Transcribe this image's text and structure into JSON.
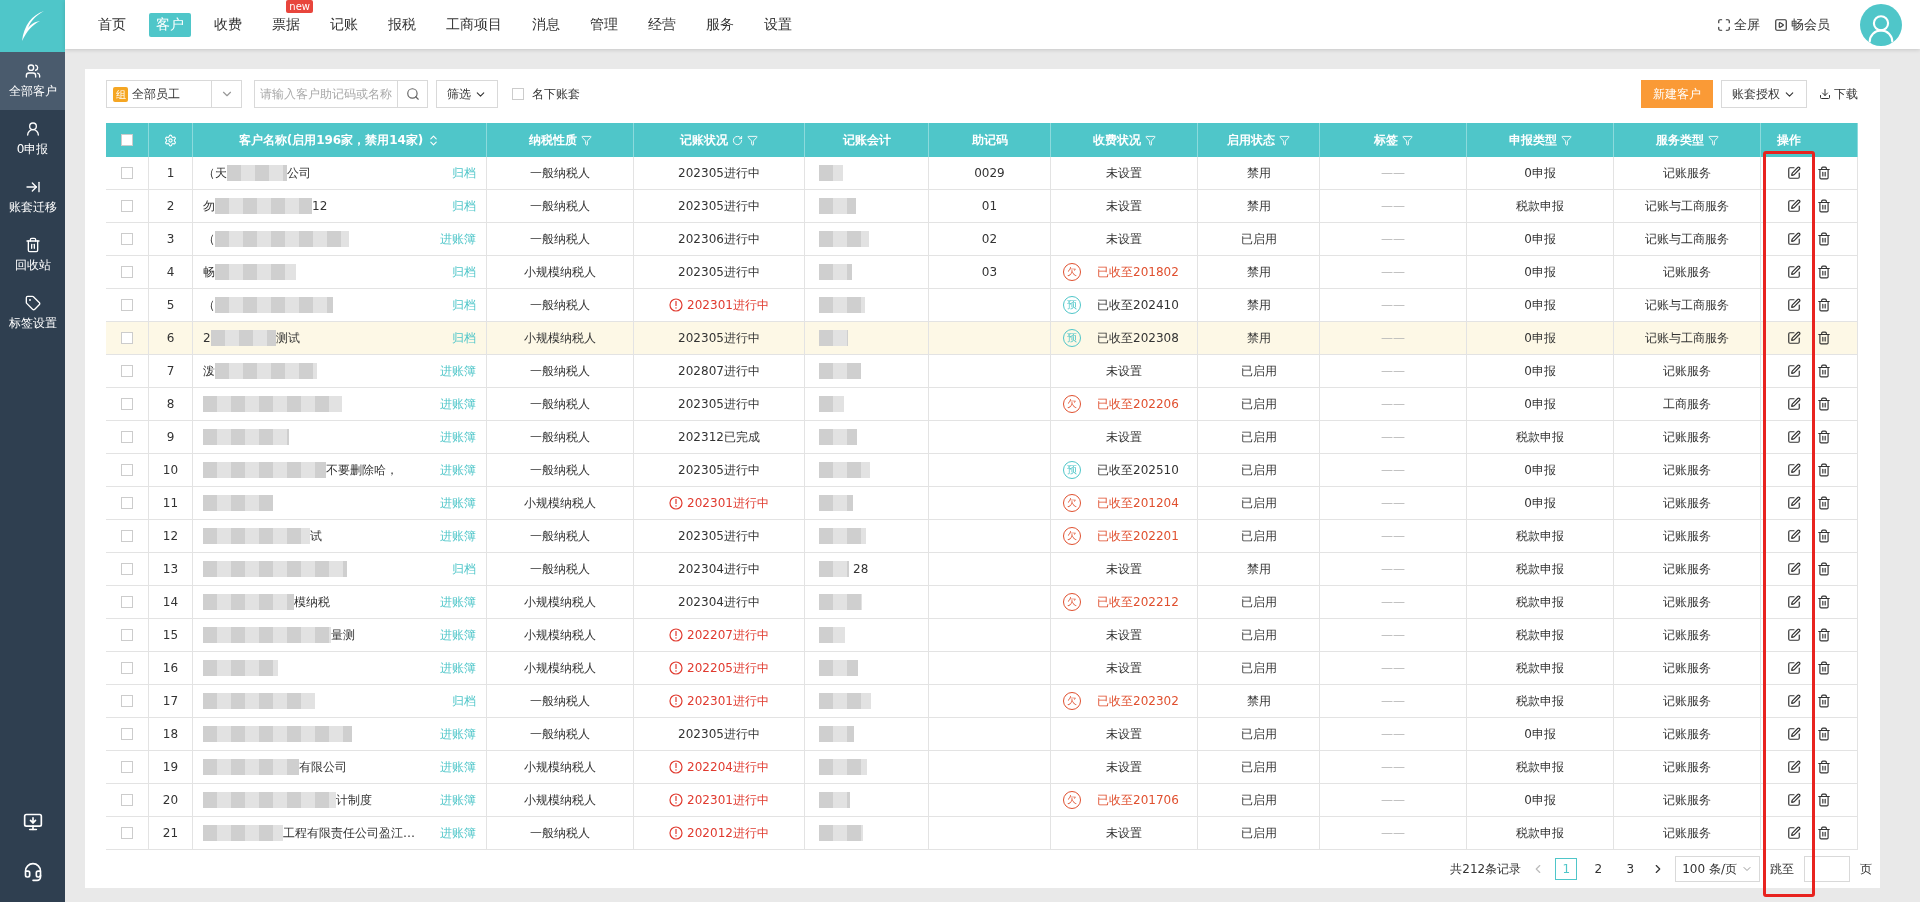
{
  "nav": {
    "items": [
      {
        "label": "首页",
        "selected": false
      },
      {
        "label": "客户",
        "selected": true
      },
      {
        "label": "收费",
        "selected": false
      },
      {
        "label": "票据",
        "selected": false,
        "badge": "new"
      },
      {
        "label": "记账",
        "selected": false
      },
      {
        "label": "报税",
        "selected": false
      },
      {
        "label": "工商项目",
        "selected": false
      },
      {
        "label": "消息",
        "selected": false
      },
      {
        "label": "管理",
        "selected": false
      },
      {
        "label": "经营",
        "selected": false
      },
      {
        "label": "服务",
        "selected": false
      },
      {
        "label": "设置",
        "selected": false
      }
    ],
    "fullscreen": "全屏",
    "member": "畅会员"
  },
  "sidebar": {
    "items": [
      {
        "label": "全部客户",
        "selected": true
      },
      {
        "label": "0申报",
        "selected": false
      },
      {
        "label": "账套迁移",
        "selected": false
      },
      {
        "label": "回收站",
        "selected": false
      },
      {
        "label": "标签设置",
        "selected": false
      }
    ]
  },
  "toolbar": {
    "staff_icon": "组",
    "staff": "全部员工",
    "search_placeholder": "请输入客户助记码或名称",
    "filter": "筛选",
    "mine": {
      "label": "名下账套",
      "checked": false
    },
    "new_customer": "新建客户",
    "authorize": "账套授权",
    "download": "下载"
  },
  "table": {
    "columns": [
      {
        "kind": "check",
        "checked": false
      },
      {
        "kind": "gear"
      },
      {
        "label": "客户名称(启用196家，禁用14家)",
        "kind": "sort"
      },
      {
        "label": "纳税性质",
        "kind": "filter"
      },
      {
        "label": "记账状况",
        "kind": "refresh"
      },
      {
        "label": "记账会计",
        "kind": "plain"
      },
      {
        "label": "助记码",
        "kind": "plain"
      },
      {
        "label": "收费状况",
        "kind": "filter"
      },
      {
        "label": "启用状态",
        "kind": "filter"
      },
      {
        "label": "标签",
        "kind": "filter"
      },
      {
        "label": "申报类型",
        "kind": "filter"
      },
      {
        "label": "服务类型",
        "kind": "filter"
      },
      {
        "label": "操作",
        "kind": "plain"
      }
    ],
    "rows": [
      {
        "no": "1",
        "name_start": "（天",
        "name_end": "公司",
        "link": "归档",
        "tax": "一般纳税人",
        "status": "202305进行中",
        "warn": false,
        "code": "0029",
        "overdue": false,
        "fee": "未设置",
        "enabled": "禁用",
        "tag": "——",
        "declare": "0申报",
        "service": "记账服务",
        "selected": false
      },
      {
        "no": "2",
        "name_start": "勿",
        "name_end": "12",
        "link": "归档",
        "tax": "一般纳税人",
        "status": "202305进行中",
        "warn": false,
        "code": "01",
        "overdue": false,
        "fee": "未设置",
        "enabled": "禁用",
        "tag": "——",
        "declare": "税款申报",
        "service": "记账与工商服务",
        "selected": false
      },
      {
        "no": "3",
        "name_start": "（",
        "link": "进账簿",
        "tax": "一般纳税人",
        "status": "202306进行中",
        "warn": false,
        "code": "02",
        "overdue": false,
        "fee": "未设置",
        "enabled": "已启用",
        "tag": "——",
        "declare": "0申报",
        "service": "记账与工商服务",
        "selected": false
      },
      {
        "no": "4",
        "name_start": "畅",
        "link": "归档",
        "tax": "小规模纳税人",
        "status": "202305进行中",
        "warn": false,
        "code": "03",
        "overdue": true,
        "fee_badge": "欠",
        "fee": "已收至201802",
        "enabled": "禁用",
        "tag": "——",
        "declare": "0申报",
        "service": "记账服务",
        "selected": false
      },
      {
        "no": "5",
        "name_start": "（",
        "link": "归档",
        "tax": "一般纳税人",
        "status": "202301进行中",
        "warn": true,
        "overdue": false,
        "fee_badge": "预",
        "fee": "已收至202410",
        "enabled": "禁用",
        "tag": "——",
        "declare": "0申报",
        "service": "记账与工商服务",
        "selected": false
      },
      {
        "no": "6",
        "name_start": "2",
        "name_end": "测试",
        "link": "归档",
        "tax": "小规模纳税人",
        "status": "202305进行中",
        "warn": false,
        "overdue": false,
        "fee_badge": "预",
        "fee": "已收至202308",
        "enabled": "禁用",
        "tag": "——",
        "declare": "0申报",
        "service": "记账与工商服务",
        "selected": true
      },
      {
        "no": "7",
        "name_start": "泼",
        "link": "进账簿",
        "tax": "一般纳税人",
        "status": "202807进行中",
        "warn": false,
        "overdue": false,
        "fee": "未设置",
        "enabled": "已启用",
        "tag": "——",
        "declare": "0申报",
        "service": "记账服务",
        "selected": false
      },
      {
        "no": "8",
        "link": "进账簿",
        "tax": "一般纳税人",
        "status": "202305进行中",
        "warn": false,
        "overdue": true,
        "fee_badge": "欠",
        "fee": "已收至202206",
        "enabled": "已启用",
        "tag": "——",
        "declare": "0申报",
        "service": "工商服务",
        "selected": false
      },
      {
        "no": "9",
        "link": "进账簿",
        "tax": "一般纳税人",
        "status": "202312已完成",
        "warn": false,
        "overdue": false,
        "fee": "未设置",
        "enabled": "已启用",
        "tag": "——",
        "declare": "税款申报",
        "service": "记账服务",
        "selected": false
      },
      {
        "no": "10",
        "name_end": "不要删除哈，",
        "link": "进账簿",
        "tax": "一般纳税人",
        "status": "202305进行中",
        "warn": false,
        "overdue": false,
        "fee_badge": "预",
        "fee": "已收至202510",
        "enabled": "已启用",
        "tag": "——",
        "declare": "0申报",
        "service": "记账服务",
        "selected": false
      },
      {
        "no": "11",
        "link": "进账簿",
        "tax": "小规模纳税人",
        "status": "202301进行中",
        "warn": true,
        "overdue": true,
        "fee_badge": "欠",
        "fee": "已收至201204",
        "enabled": "已启用",
        "tag": "——",
        "declare": "0申报",
        "service": "记账服务",
        "selected": false
      },
      {
        "no": "12",
        "name_end": "试",
        "link": "进账簿",
        "tax": "一般纳税人",
        "status": "202305进行中",
        "warn": false,
        "overdue": true,
        "fee_badge": "欠",
        "fee": "已收至202201",
        "enabled": "已启用",
        "tag": "——",
        "declare": "税款申报",
        "service": "记账服务",
        "selected": false
      },
      {
        "no": "13",
        "link": "归档",
        "tax": "一般纳税人",
        "status": "202304进行中",
        "warn": false,
        "accountant_end": "28",
        "overdue": false,
        "fee": "未设置",
        "enabled": "禁用",
        "tag": "——",
        "declare": "税款申报",
        "service": "记账服务",
        "selected": false
      },
      {
        "no": "14",
        "name_end": "模纳税",
        "link": "进账簿",
        "tax": "小规模纳税人",
        "status": "202304进行中",
        "warn": false,
        "overdue": true,
        "fee_badge": "欠",
        "fee": "已收至202212",
        "enabled": "已启用",
        "tag": "——",
        "declare": "税款申报",
        "service": "记账服务",
        "selected": false
      },
      {
        "no": "15",
        "name_end": "量测",
        "link": "进账簿",
        "tax": "小规模纳税人",
        "status": "202207进行中",
        "warn": true,
        "overdue": false,
        "fee": "未设置",
        "enabled": "已启用",
        "tag": "——",
        "declare": "税款申报",
        "service": "记账服务",
        "selected": false
      },
      {
        "no": "16",
        "link": "进账簿",
        "tax": "小规模纳税人",
        "status": "202205进行中",
        "warn": true,
        "overdue": false,
        "fee": "未设置",
        "enabled": "已启用",
        "tag": "——",
        "declare": "税款申报",
        "service": "记账服务",
        "selected": false
      },
      {
        "no": "17",
        "link": "归档",
        "tax": "一般纳税人",
        "status": "202301进行中",
        "warn": true,
        "overdue": true,
        "fee_badge": "欠",
        "fee": "已收至202302",
        "enabled": "禁用",
        "tag": "——",
        "declare": "税款申报",
        "service": "记账服务",
        "selected": false
      },
      {
        "no": "18",
        "link": "进账簿",
        "tax": "一般纳税人",
        "status": "202305进行中",
        "warn": false,
        "overdue": false,
        "fee": "未设置",
        "enabled": "已启用",
        "tag": "——",
        "declare": "0申报",
        "service": "记账服务",
        "selected": false
      },
      {
        "no": "19",
        "name_end": "有限公司",
        "link": "进账簿",
        "tax": "小规模纳税人",
        "status": "202204进行中",
        "warn": true,
        "overdue": false,
        "fee": "未设置",
        "enabled": "已启用",
        "tag": "——",
        "declare": "税款申报",
        "service": "记账服务",
        "selected": false
      },
      {
        "no": "20",
        "name_end": "计制度",
        "link": "进账簿",
        "tax": "小规模纳税人",
        "status": "202301进行中",
        "warn": true,
        "overdue": true,
        "fee_badge": "欠",
        "fee": "已收至201706",
        "enabled": "已启用",
        "tag": "——",
        "declare": "0申报",
        "service": "记账服务",
        "selected": false
      },
      {
        "no": "21",
        "name_end": "工程有限责任公司盈江…",
        "link": "进账簿",
        "tax": "一般纳税人",
        "status": "202012进行中",
        "warn": true,
        "overdue": false,
        "fee": "未设置",
        "enabled": "已启用",
        "tag": "——",
        "declare": "税款申报",
        "service": "记账服务",
        "selected": false
      }
    ]
  },
  "pagination": {
    "total": "共212条记录",
    "pages": [
      {
        "label": "1",
        "selected": true
      },
      {
        "label": "2",
        "selected": false
      },
      {
        "label": "3",
        "selected": false
      }
    ],
    "page_size": "100 条/页",
    "jump": "跳至",
    "page_unit": "页"
  }
}
